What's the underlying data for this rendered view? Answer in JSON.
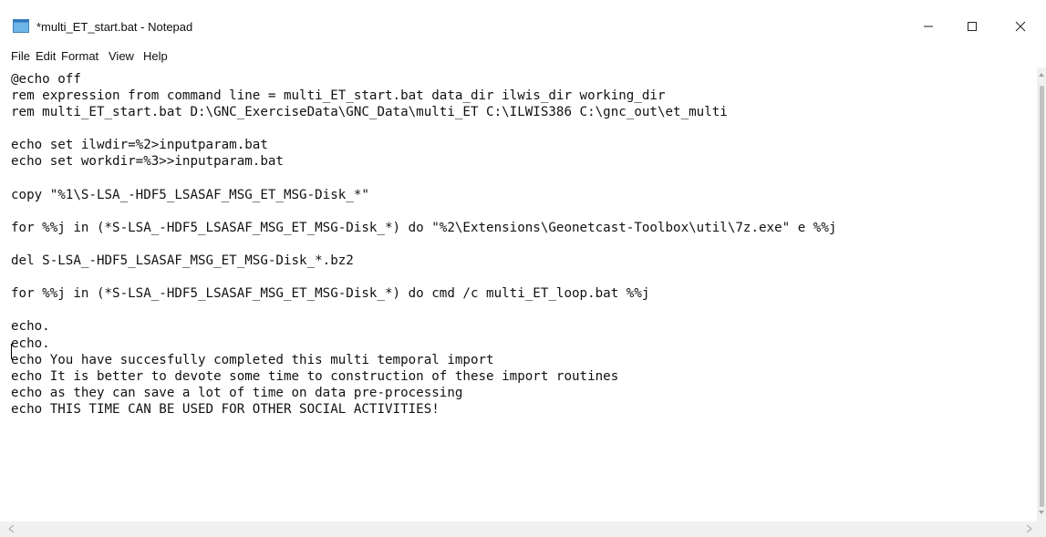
{
  "window": {
    "title": "*multi_ET_start.bat - Notepad",
    "icon": "notepad-icon"
  },
  "menu": {
    "items": [
      "File",
      "Edit",
      "Format",
      "View",
      "Help"
    ]
  },
  "editor": {
    "lines": [
      "@echo off",
      "rem expression from command line = multi_ET_start.bat data_dir ilwis_dir working_dir",
      "rem multi_ET_start.bat D:\\GNC_ExerciseData\\GNC_Data\\multi_ET C:\\ILWIS386 C:\\gnc_out\\et_multi",
      "",
      "echo set ilwdir=%2>inputparam.bat",
      "echo set workdir=%3>>inputparam.bat",
      "",
      "copy \"%1\\S-LSA_-HDF5_LSASAF_MSG_ET_MSG-Disk_*\"",
      "",
      "for %%j in (*S-LSA_-HDF5_LSASAF_MSG_ET_MSG-Disk_*) do \"%2\\Extensions\\Geonetcast-Toolbox\\util\\7z.exe\" e %%j",
      "",
      "del S-LSA_-HDF5_LSASAF_MSG_ET_MSG-Disk_*.bz2",
      "",
      "for %%j in (*S-LSA_-HDF5_LSASAF_MSG_ET_MSG-Disk_*) do cmd /c multi_ET_loop.bat %%j",
      "",
      "echo.",
      "echo.",
      "echo You have succesfully completed this multi temporal import",
      "echo It is better to devote some time to construction of these import routines",
      "echo as they can save a lot of time on data pre-processing",
      "echo THIS TIME CAN BE USED FOR OTHER SOCIAL ACTIVITIES!"
    ]
  }
}
